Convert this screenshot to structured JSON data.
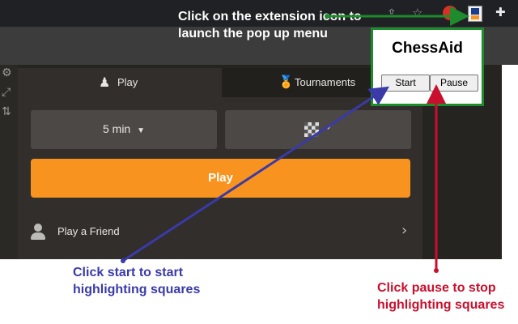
{
  "annotations": {
    "extension_hint": "Click on the extension icon to launch the pop up menu",
    "start_hint": "Click start to start highlighting squares",
    "pause_hint": "Click pause to stop highlighting squares"
  },
  "popup": {
    "title": "ChessAid",
    "start_label": "Start",
    "pause_label": "Pause"
  },
  "chess_ui": {
    "tabs": [
      {
        "label": "Play",
        "icon": "pawn-icon"
      },
      {
        "label": "Tournaments",
        "icon": "medal-icon"
      }
    ],
    "time_control": "5 min",
    "play_button": "Play",
    "play_friend": "Play a Friend"
  },
  "colors": {
    "accent_orange": "#f7931e",
    "popup_border_green": "#1e8b2c",
    "start_arrow_blue": "#3a3aa8",
    "pause_arrow_red": "#c8102e",
    "app_background": "#262421"
  }
}
